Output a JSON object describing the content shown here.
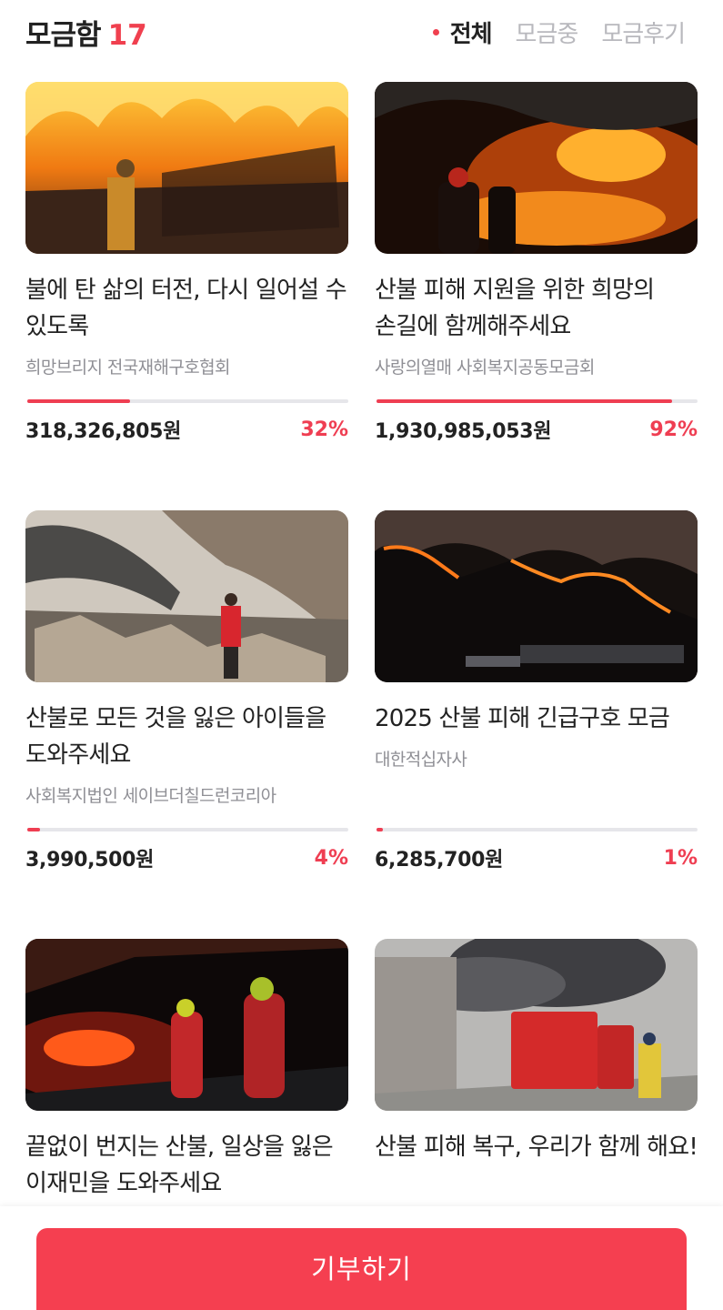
{
  "header": {
    "title": "모금함",
    "count": "17",
    "tabs": [
      {
        "label": "전체",
        "active": true
      },
      {
        "label": "모금중",
        "active": false
      },
      {
        "label": "모금후기",
        "active": false
      }
    ]
  },
  "campaigns": [
    {
      "title": "불에 탄 삶의 터전, 다시 일어설 수 있도록",
      "org": "희망브리지 전국재해구호협회",
      "amount": "318,326,805원",
      "percent": "32%",
      "progress": 0.32,
      "image": "firefighter-burning-house"
    },
    {
      "title": "산불 피해 지원을 위한 희망의 손길에 함께해주세요",
      "org": "사랑의열매 사회복지공동모금회",
      "amount": "1,930,985,053원",
      "percent": "92%",
      "progress": 0.92,
      "image": "firefighters-night-fire"
    },
    {
      "title": "산불로 모든 것을 잃은 아이들을 도와주세요",
      "org": "사회복지법인 세이브더칠드런코리아",
      "amount": "3,990,500원",
      "percent": "4%",
      "progress": 0.04,
      "image": "collapsed-house-ruins"
    },
    {
      "title": "2025 산불 피해 긴급구호 모금",
      "org": "대한적십자사",
      "amount": "6,285,700원",
      "percent": "1%",
      "progress": 0.01,
      "image": "mountain-wildfire-night"
    },
    {
      "title": "끝없이 번지는 산불, 일상을 잃은 이재민을 도와주세요",
      "org": "",
      "amount": "",
      "percent": "",
      "progress": null,
      "image": "firefighters-forest-night"
    },
    {
      "title": "산불 피해 복구, 우리가 함께 해요!",
      "org": "",
      "amount": "",
      "percent": "",
      "progress": null,
      "image": "fire-trucks-smoke"
    }
  ],
  "footer": {
    "donate_label": "기부하기"
  },
  "colors": {
    "accent": "#ef3e52",
    "button": "#f53f50",
    "text": "#222222",
    "muted": "#8f8f95"
  }
}
